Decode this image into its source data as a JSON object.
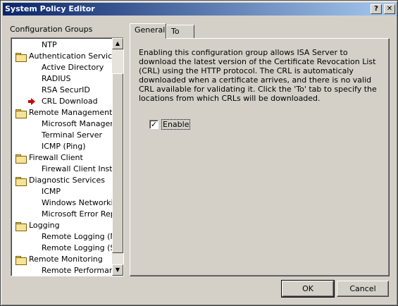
{
  "window": {
    "title": "System Policy Editor",
    "help_glyph": "?",
    "close_glyph": "✕"
  },
  "groups": {
    "label": "Configuration Groups",
    "items": [
      {
        "label": "NTP",
        "level": 1,
        "icon": "none"
      },
      {
        "label": "Authentication Services",
        "level": 0,
        "icon": "folder-icon"
      },
      {
        "label": "Active Directory",
        "level": 1,
        "icon": "none"
      },
      {
        "label": "RADIUS",
        "level": 1,
        "icon": "none"
      },
      {
        "label": "RSA SecurID",
        "level": 1,
        "icon": "none"
      },
      {
        "label": "CRL Download",
        "level": 1,
        "icon": "arrow-icon",
        "selected": true
      },
      {
        "label": "Remote Management",
        "level": 0,
        "icon": "folder-icon"
      },
      {
        "label": "Microsoft Manageme",
        "level": 1,
        "icon": "none"
      },
      {
        "label": "Terminal Server",
        "level": 1,
        "icon": "none"
      },
      {
        "label": "ICMP (Ping)",
        "level": 1,
        "icon": "none"
      },
      {
        "label": "Firewall Client",
        "level": 0,
        "icon": "folder-icon"
      },
      {
        "label": "Firewall Client Install",
        "level": 1,
        "icon": "none"
      },
      {
        "label": "Diagnostic Services",
        "level": 0,
        "icon": "folder-icon"
      },
      {
        "label": "ICMP",
        "level": 1,
        "icon": "none"
      },
      {
        "label": "Windows Networking",
        "level": 1,
        "icon": "none"
      },
      {
        "label": "Microsoft Error Repo",
        "level": 1,
        "icon": "none"
      },
      {
        "label": "Logging",
        "level": 0,
        "icon": "folder-icon"
      },
      {
        "label": "Remote Logging (Ne",
        "level": 1,
        "icon": "none"
      },
      {
        "label": "Remote Logging (SQ",
        "level": 1,
        "icon": "none"
      },
      {
        "label": "Remote Monitoring",
        "level": 0,
        "icon": "folder-icon"
      },
      {
        "label": "Remote Performance",
        "level": 1,
        "icon": "none"
      }
    ],
    "scroll_up_glyph": "▲",
    "scroll_down_glyph": "▼"
  },
  "tabs": [
    {
      "label": "General",
      "active": true
    },
    {
      "label": "To",
      "active": false
    }
  ],
  "general": {
    "description": "Enabling this configuration group allows ISA Server to download the latest version of the Certificate Revocation List (CRL) using the HTTP protocol. The CRL is automaticaly downloaded when a certificate arrives, and there is no valid CRL available for validating it. Click the 'To' tab to specify the locations from which CRLs will be downloaded.",
    "enable_label": "Enable",
    "enable_checked": true,
    "check_glyph": "✓"
  },
  "buttons": {
    "ok": "OK",
    "cancel": "Cancel"
  }
}
